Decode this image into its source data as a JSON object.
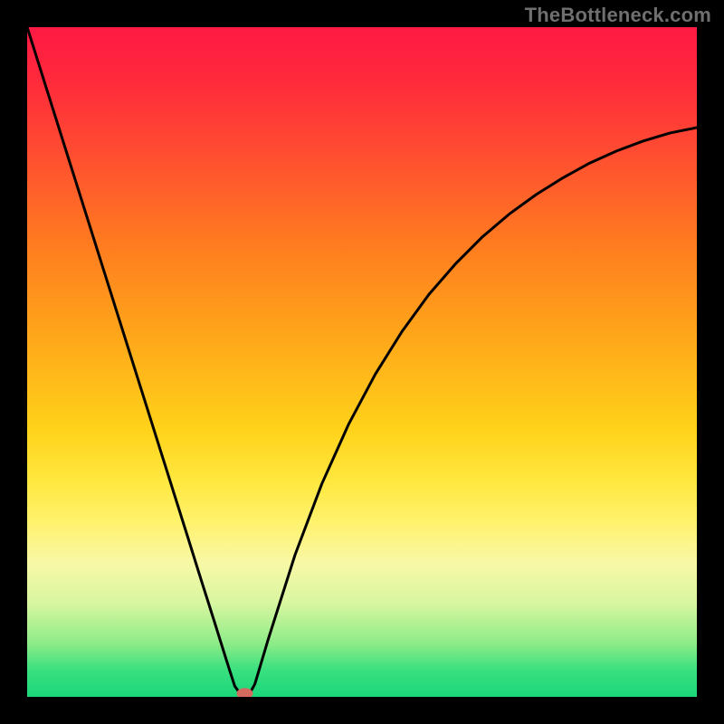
{
  "watermark": "TheBottleneck.com",
  "chart_data": {
    "type": "line",
    "title": "",
    "xlabel": "",
    "ylabel": "",
    "xlim": [
      0,
      100
    ],
    "ylim": [
      0,
      100
    ],
    "x": [
      0,
      4,
      8,
      12,
      16,
      20,
      24,
      26,
      28,
      29,
      30,
      31,
      32,
      33,
      34,
      36,
      40,
      44,
      48,
      52,
      56,
      60,
      64,
      68,
      72,
      76,
      80,
      84,
      88,
      92,
      96,
      100
    ],
    "values": [
      100,
      87.3,
      74.6,
      61.9,
      49.2,
      36.5,
      23.8,
      17.4,
      11.1,
      7.9,
      4.7,
      1.6,
      0.2,
      0.1,
      1.9,
      8.6,
      21.2,
      31.8,
      40.7,
      48.2,
      54.6,
      60.1,
      64.7,
      68.7,
      72.1,
      75.0,
      77.5,
      79.7,
      81.5,
      83.0,
      84.2,
      85.0
    ],
    "marker_point": {
      "x": 32.5,
      "y": 0.5
    },
    "background_gradient": [
      "#ff1a44",
      "#ffd21a",
      "#1bd67a"
    ],
    "grid": false,
    "legend": false
  }
}
